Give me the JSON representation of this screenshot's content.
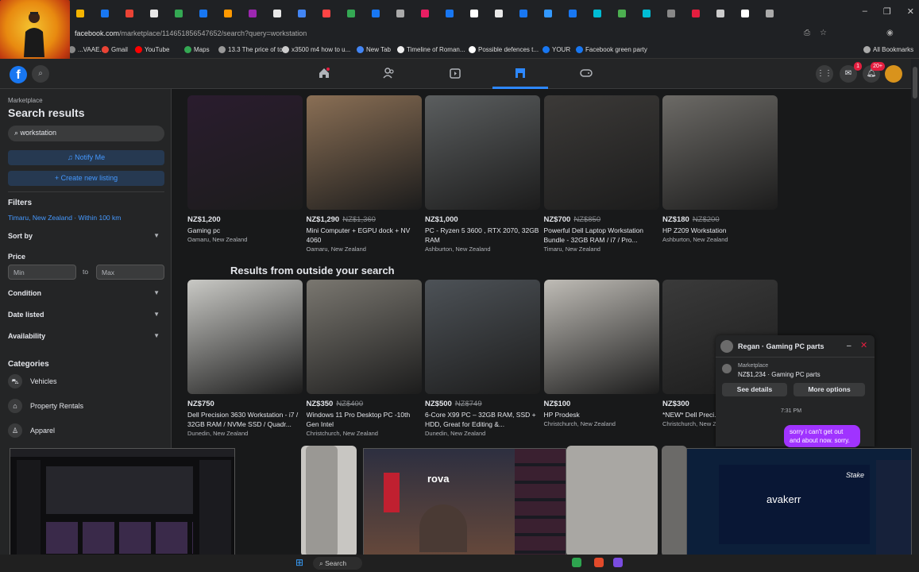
{
  "browser": {
    "url_host": "facebook.com",
    "url_path": "/marketplace/114651856547652/search?query=workstation",
    "bookmarks": [
      {
        "label": "...VAAE...",
        "color": "#888"
      },
      {
        "label": "Gmail",
        "color": "#ea4335"
      },
      {
        "label": "YouTube",
        "color": "#ff0000"
      },
      {
        "label": "Maps",
        "color": "#34a853"
      },
      {
        "label": "13.3 The price of to...",
        "color": "#999"
      },
      {
        "label": "x3500 m4 how to u...",
        "color": "#ccc"
      },
      {
        "label": "New Tab",
        "color": "#4285f4"
      },
      {
        "label": "Timeline of Roman...",
        "color": "#eee"
      },
      {
        "label": "Possible defences t...",
        "color": "#fff"
      },
      {
        "label": "YOUR",
        "color": "#1877f2"
      },
      {
        "label": "Facebook green party",
        "color": "#1877f2"
      },
      {
        "label": "All Bookmarks",
        "color": "#aaa"
      }
    ],
    "window_controls": [
      "–",
      "❐",
      "✕"
    ]
  },
  "nav": {
    "logo": "f",
    "badges": {
      "messenger": "1",
      "notifications": "20+"
    }
  },
  "sidebar": {
    "breadcrumb": "Marketplace",
    "title": "Search results",
    "search_value": "workstation",
    "notify_label": "Notify Me",
    "create_label": "+ Create new listing",
    "filters_heading": "Filters",
    "location": "Timaru, New Zealand · Within 100 km",
    "sort_by": "Sort by",
    "price_label": "Price",
    "min_placeholder": "Min",
    "to_label": "to",
    "max_placeholder": "Max",
    "condition": "Condition",
    "date_listed": "Date listed",
    "availability": "Availability",
    "categories_heading": "Categories",
    "categories": [
      "Vehicles",
      "Property Rentals",
      "Apparel"
    ]
  },
  "main": {
    "outside_heading": "Results from outside your search",
    "row1": [
      {
        "price": "NZ$1,200",
        "old": "",
        "title": "Gaming pc",
        "loc": "Oamaru, New Zealand",
        "bg": "#2a1c2e"
      },
      {
        "price": "NZ$1,290",
        "old": "NZ$1,360",
        "title": "Mini Computer + EGPU dock + NV 4060",
        "loc": "Oamaru, New Zealand",
        "bg": "#8a6f55"
      },
      {
        "price": "NZ$1,000",
        "old": "",
        "title": "PC - Ryzen 5 3600 , RTX 2070, 32GB RAM",
        "loc": "Ashburton, New Zealand",
        "bg": "#5b5e5f"
      },
      {
        "price": "NZ$700",
        "old": "NZ$850",
        "title": "Powerful Dell Laptop Workstation Bundle - 32GB RAM / i7 / Pro...",
        "loc": "Timaru, New Zealand",
        "bg": "#3c3a38"
      },
      {
        "price": "NZ$180",
        "old": "NZ$200",
        "title": "HP Z209 Workstation",
        "loc": "Ashburton, New Zealand",
        "bg": "#6c6a66"
      }
    ],
    "row2": [
      {
        "price": "NZ$750",
        "old": "",
        "title": "Dell Precision 3630 Workstation - i7 / 32GB RAM / NVMe SSD / Quadr...",
        "loc": "Dunedin, New Zealand",
        "bg": "#c9c9c5"
      },
      {
        "price": "NZ$350",
        "old": "NZ$400",
        "title": "Windows 11 Pro Desktop PC -10th Gen Intel",
        "loc": "Christchurch, New Zealand",
        "bg": "#7a7770"
      },
      {
        "price": "NZ$500",
        "old": "NZ$749",
        "title": "6-Core X99 PC – 32GB RAM, SSD + HDD, Great for Editing &...",
        "loc": "Dunedin, New Zealand",
        "bg": "#4d5257"
      },
      {
        "price": "NZ$100",
        "old": "",
        "title": "HP Prodesk",
        "loc": "Christchurch, New Zealand",
        "bg": "#bfbcb6"
      },
      {
        "price": "NZ$300",
        "old": "",
        "title": "*NEW* Dell Preci...",
        "loc": "Christchurch, New Z...",
        "bg": "#3a3a3a"
      }
    ]
  },
  "chat": {
    "name": "Regan · Gaming PC parts",
    "sub1": "Marketplace",
    "sub2": "NZ$1,234 · Gaming PC parts",
    "see_details": "See details",
    "more_options": "More options",
    "time": "7:31 PM",
    "message": "sorry i can't get out and about now. sorry."
  },
  "overlays": {
    "ov2_text": "rova",
    "ov3_text": "avakerr",
    "ov3_brand": "Stake"
  },
  "taskbar": {
    "search": "Search"
  }
}
